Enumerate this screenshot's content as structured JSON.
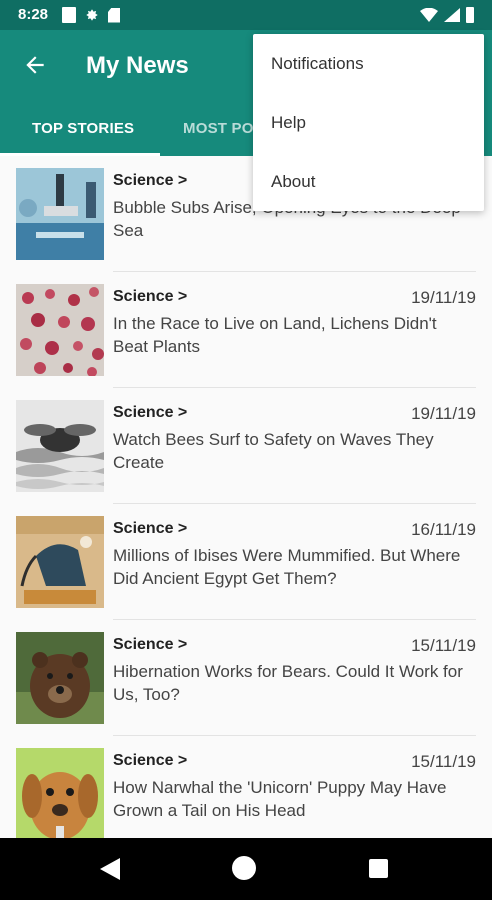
{
  "status": {
    "time": "8:28"
  },
  "app_bar": {
    "title": "My News"
  },
  "tabs": [
    {
      "label": "TOP STORIES"
    },
    {
      "label": "MOST PO"
    }
  ],
  "menu": {
    "items": [
      {
        "label": "Notifications"
      },
      {
        "label": "Help"
      },
      {
        "label": "About"
      }
    ]
  },
  "articles": [
    {
      "category": "Science >",
      "date": "",
      "headline": "Bubble Subs Arise, Opening Eyes to the Deep Sea"
    },
    {
      "category": "Science >",
      "date": "19/11/19",
      "headline": "In the Race to Live on Land, Lichens Didn't Beat Plants"
    },
    {
      "category": "Science >",
      "date": "19/11/19",
      "headline": "Watch Bees Surf to Safety on Waves They Create"
    },
    {
      "category": "Science >",
      "date": "16/11/19",
      "headline": "Millions of Ibises Were Mummified. But Where Did Ancient Egypt Get Them?"
    },
    {
      "category": "Science >",
      "date": "15/11/19",
      "headline": "Hibernation Works for Bears. Could It Work for Us, Too?"
    },
    {
      "category": "Science >",
      "date": "15/11/19",
      "headline": "How Narwhal the 'Unicorn' Puppy May Have Grown a Tail on His Head"
    }
  ],
  "colors": {
    "primary": "#168a7c",
    "status_bar": "#0f6e63"
  }
}
